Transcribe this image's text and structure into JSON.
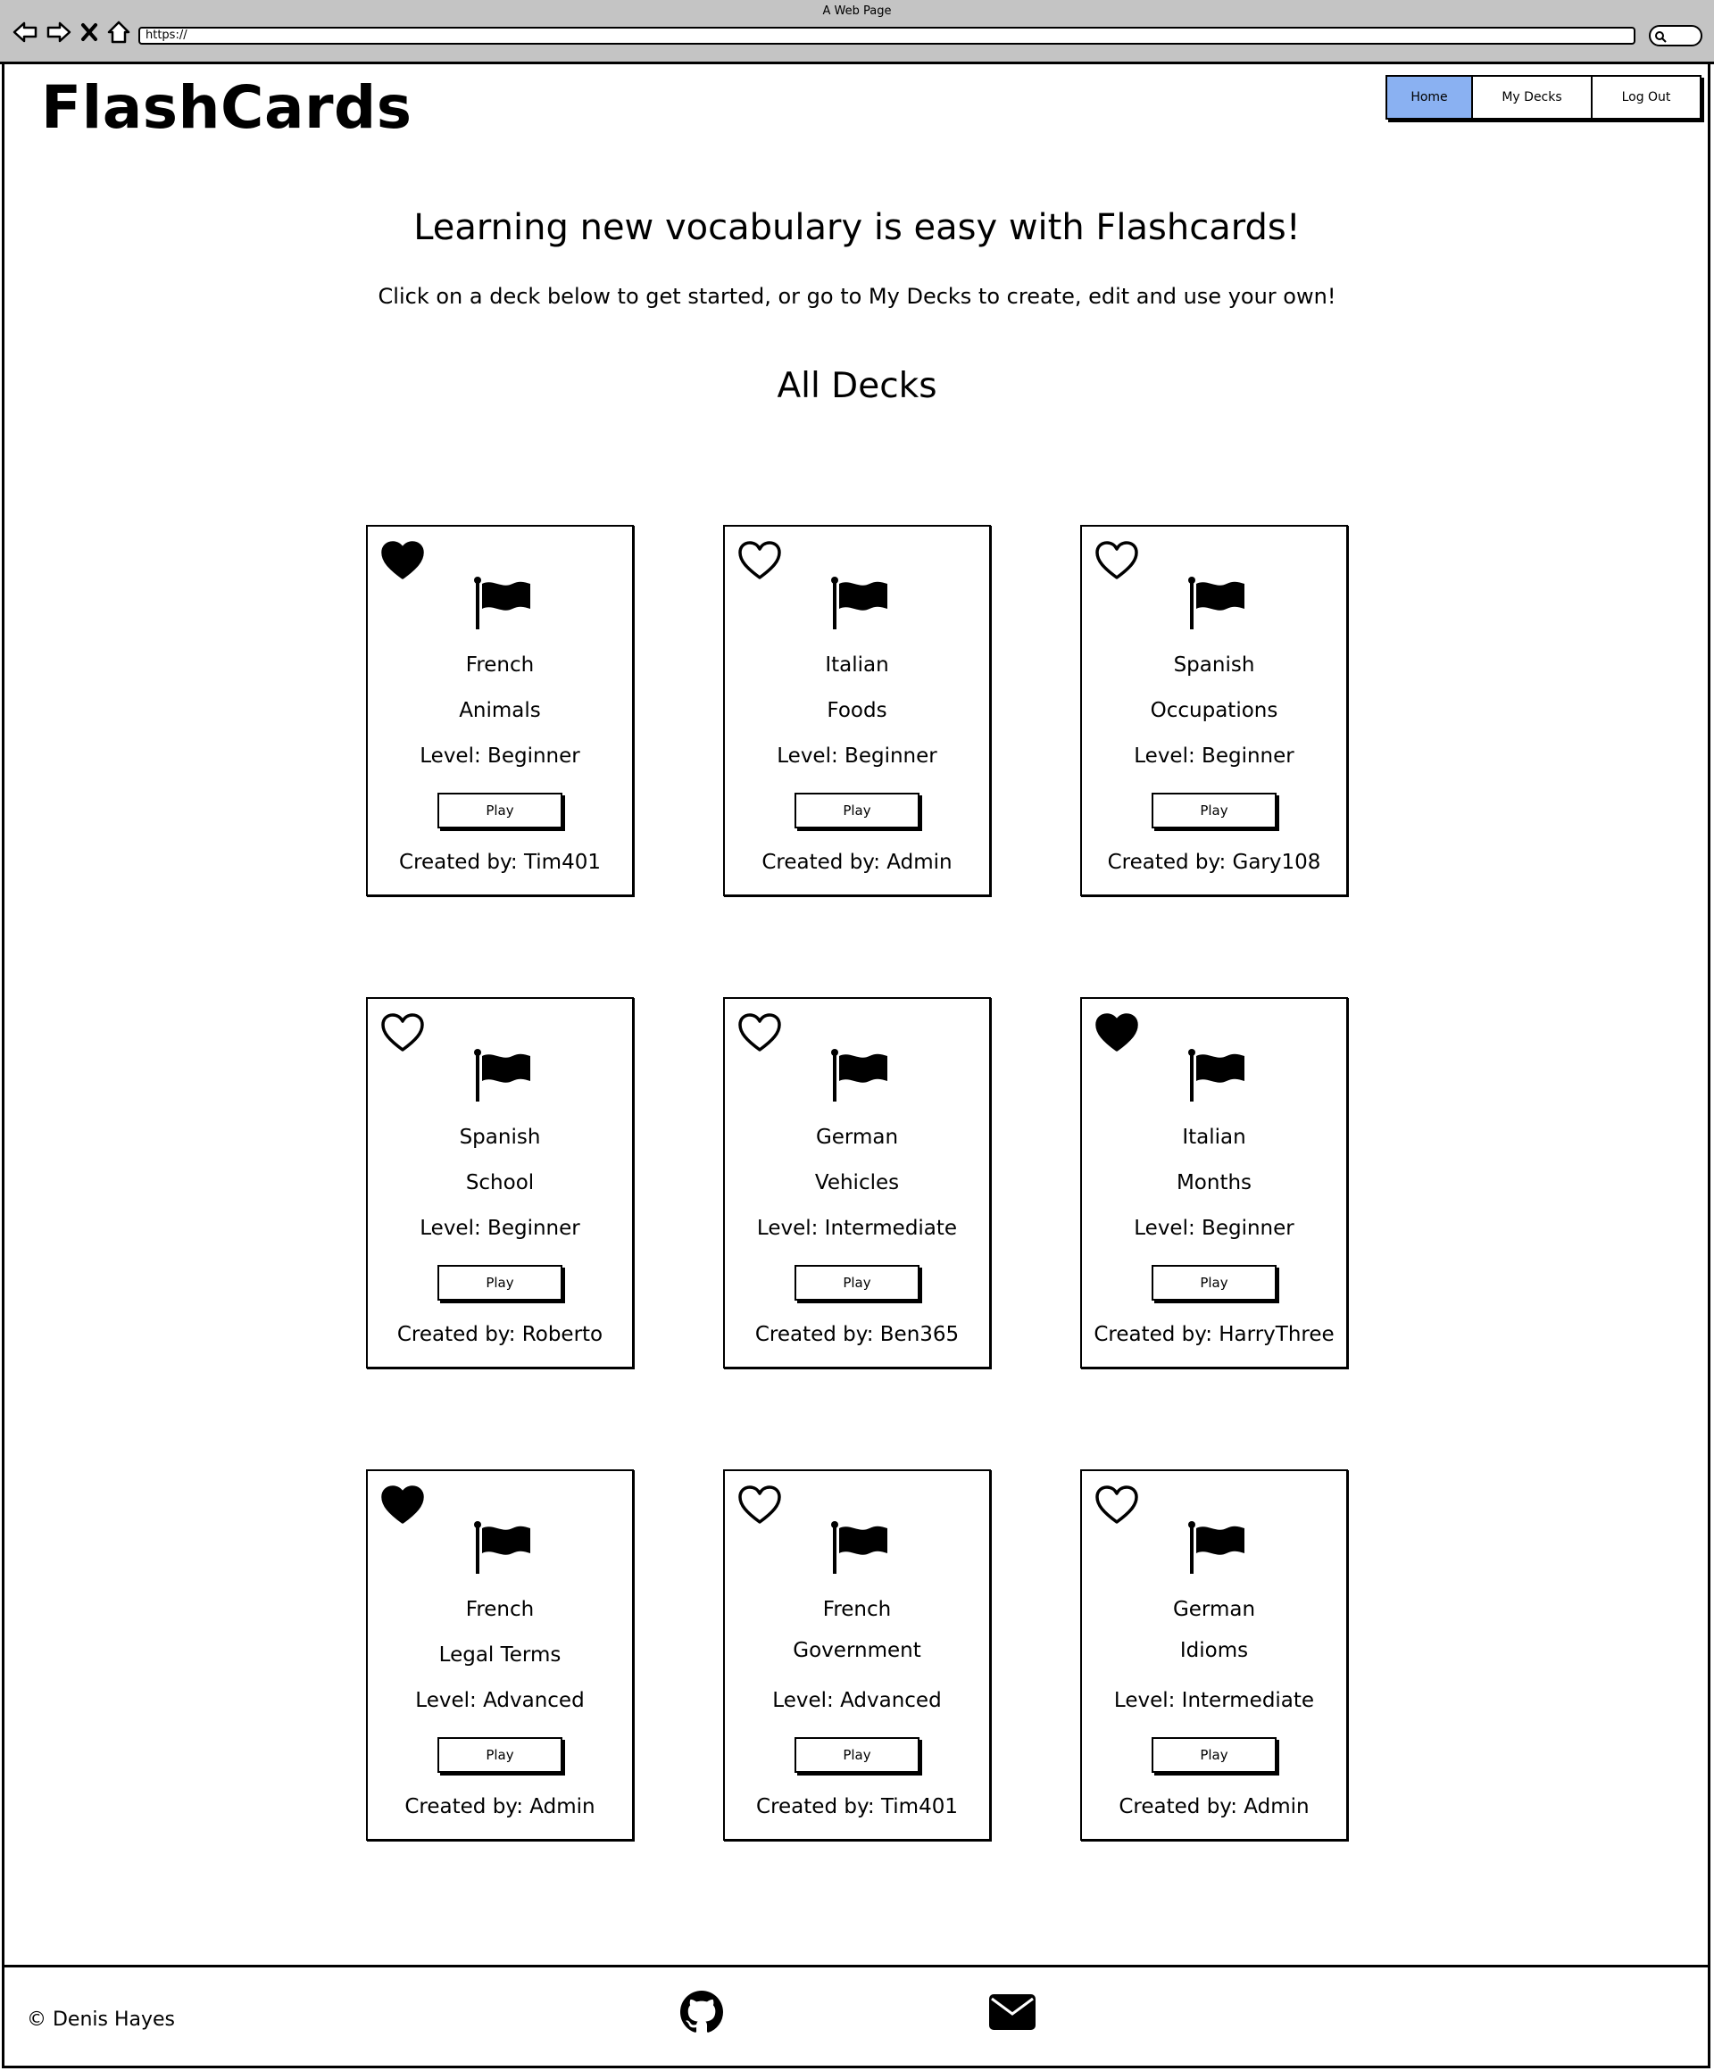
{
  "browser": {
    "window_title": "A Web Page",
    "url": "https://"
  },
  "header": {
    "logo": "FlashCards",
    "nav": [
      {
        "label": "Home",
        "active": true
      },
      {
        "label": "My Decks",
        "active": false
      },
      {
        "label": "Log Out",
        "active": false
      }
    ]
  },
  "intro": {
    "headline": "Learning new vocabulary is easy with Flashcards!",
    "subline": "Click on a deck below to get started, or go to My Decks to create, edit and use your own!",
    "section_title": "All Decks"
  },
  "decks": [
    {
      "language": "French",
      "topic": "Animals",
      "level": "Level: Beginner",
      "play_label": "Play",
      "created_by": "Created by: Tim401",
      "favorited": true
    },
    {
      "language": "Italian",
      "topic": "Foods",
      "level": "Level: Beginner",
      "play_label": "Play",
      "created_by": "Created by: Admin",
      "favorited": false
    },
    {
      "language": "Spanish",
      "topic": "Occupations",
      "level": "Level: Beginner",
      "play_label": "Play",
      "created_by": "Created by: Gary108",
      "favorited": false
    },
    {
      "language": "Spanish",
      "topic": "School",
      "level": "Level: Beginner",
      "play_label": "Play",
      "created_by": "Created by: Roberto",
      "favorited": false
    },
    {
      "language": "German",
      "topic": "Vehicles",
      "level": "Level: Intermediate",
      "play_label": "Play",
      "created_by": "Created by: Ben365",
      "favorited": false
    },
    {
      "language": "Italian",
      "topic": "Months",
      "level": "Level: Beginner",
      "play_label": "Play",
      "created_by": "Created by: HarryThree",
      "favorited": true
    },
    {
      "language": "French",
      "topic": "Legal Terms",
      "level": "Level: Advanced",
      "play_label": "Play",
      "created_by": "Created by: Admin",
      "favorited": true
    },
    {
      "language": "French",
      "topic": "Government",
      "level": "Level: Advanced",
      "play_label": "Play",
      "created_by": "Created by: Tim401",
      "favorited": false
    },
    {
      "language": "German",
      "topic": "Idioms",
      "level": "Level: Intermediate",
      "play_label": "Play",
      "created_by": "Created by: Admin",
      "favorited": false
    }
  ],
  "icons": {
    "favorite": "heart-icon",
    "language": "flag-icon",
    "footer": [
      "github-icon",
      "mail-icon"
    ]
  },
  "footer": {
    "copyright": "© Denis Hayes"
  },
  "colors": {
    "active_tab": "#8ab1f2",
    "chrome": "#c4c4c4"
  }
}
